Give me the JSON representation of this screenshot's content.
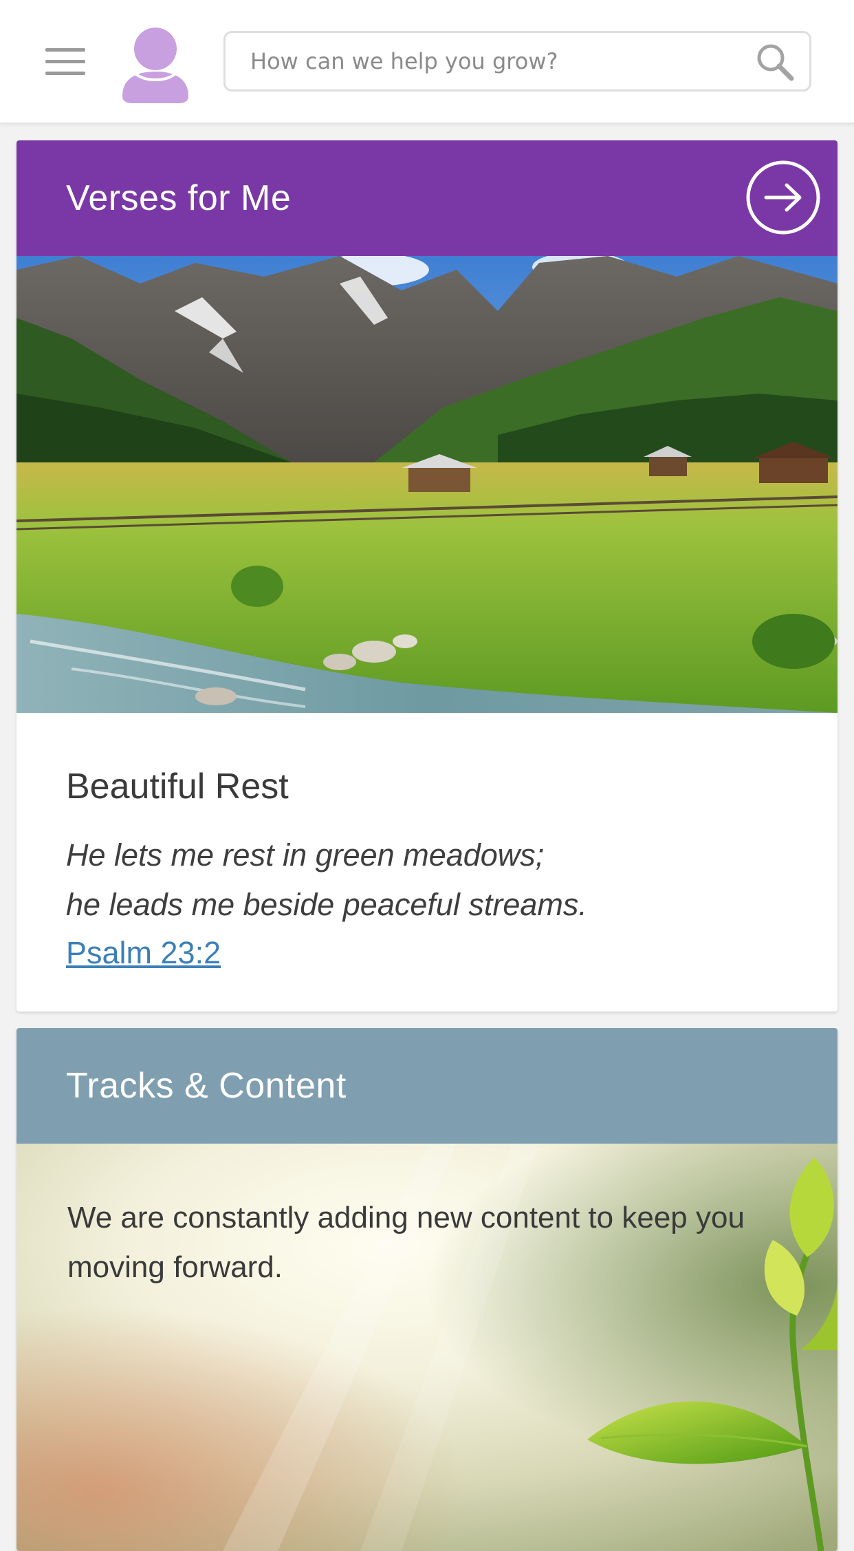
{
  "header": {
    "menu_icon": "hamburger-menu-icon",
    "avatar_icon": "user-avatar-icon",
    "search": {
      "placeholder": "How can we help you grow?",
      "value": "",
      "icon": "search-icon"
    }
  },
  "verses_card": {
    "title": "Verses for Me",
    "header_color": "#7a38a6",
    "action_icon": "arrow-right-circle-icon",
    "image": "mountain-meadow-stream-landscape",
    "verse_title": "Beautiful Rest",
    "verse_lines": [
      "He lets me rest in green meadows;",
      "he leads me beside peaceful streams."
    ],
    "reference": "Psalm 23:2",
    "link_color": "#3c7fb8"
  },
  "tracks_card": {
    "title": "Tracks & Content",
    "header_color": "#7f9fb0",
    "image": "green-leaf-sprout-sunlight",
    "text": "We are constantly adding new content to keep you moving forward."
  },
  "colors": {
    "avatar": "#c8a0e0",
    "page_background": "#f2f2f3"
  }
}
